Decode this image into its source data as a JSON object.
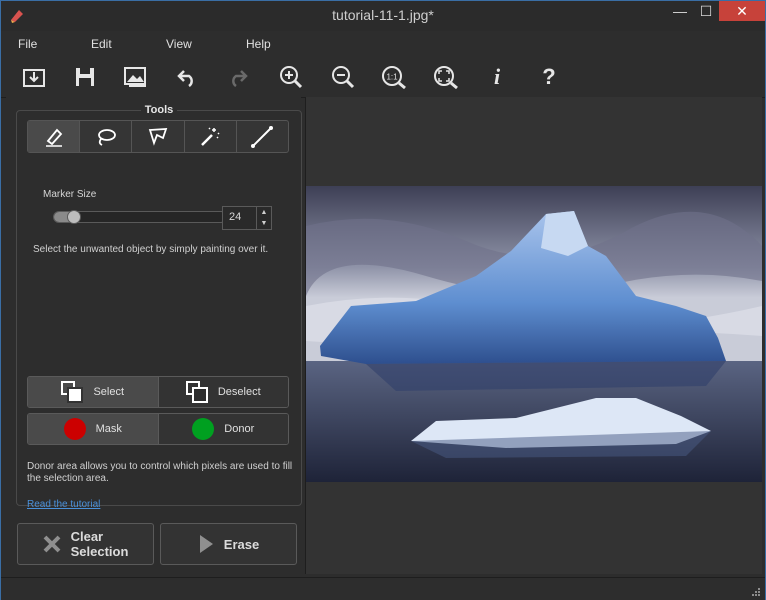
{
  "window": {
    "title": "tutorial-11-1.jpg*",
    "minimize": "—",
    "maximize": "☐",
    "close": "✕"
  },
  "menu": [
    "File",
    "Edit",
    "View",
    "Help"
  ],
  "toolbar": {
    "buttons": [
      "open-icon",
      "save-icon",
      "export-image-icon",
      "undo-icon",
      "redo-icon",
      "zoom-in-icon",
      "zoom-out-icon",
      "actual-size-icon",
      "fit-screen-icon",
      "info-icon",
      "help-icon"
    ],
    "info_glyph": "i",
    "help_glyph": "?",
    "actual_size_glyph": "1:1"
  },
  "tools": {
    "heading": "Tools",
    "items": [
      "marker-icon",
      "lasso-icon",
      "polygonal-lasso-icon",
      "magic-wand-icon",
      "line-icon"
    ],
    "active_index": 0
  },
  "marker": {
    "label": "Marker Size",
    "value": "24",
    "slider_fraction": 0.05
  },
  "hint": "Select the unwanted object by simply painting over it.",
  "selection": {
    "select_label": "Select",
    "deselect_label": "Deselect"
  },
  "area": {
    "mask_label": "Mask",
    "donor_label": "Donor",
    "mask_color": "#cc0000",
    "donor_color": "#00a020"
  },
  "donor_note": "Donor area allows you to control which pixels are used to fill the selection area.",
  "tutorial_link": "Read the tutorial",
  "actions": {
    "clear_label_1": "Clear",
    "clear_label_2": "Selection",
    "erase_label": "Erase"
  },
  "colors": {
    "window_border": "#3a6ea5",
    "close_red": "#c7423a",
    "link": "#4a90d9"
  }
}
